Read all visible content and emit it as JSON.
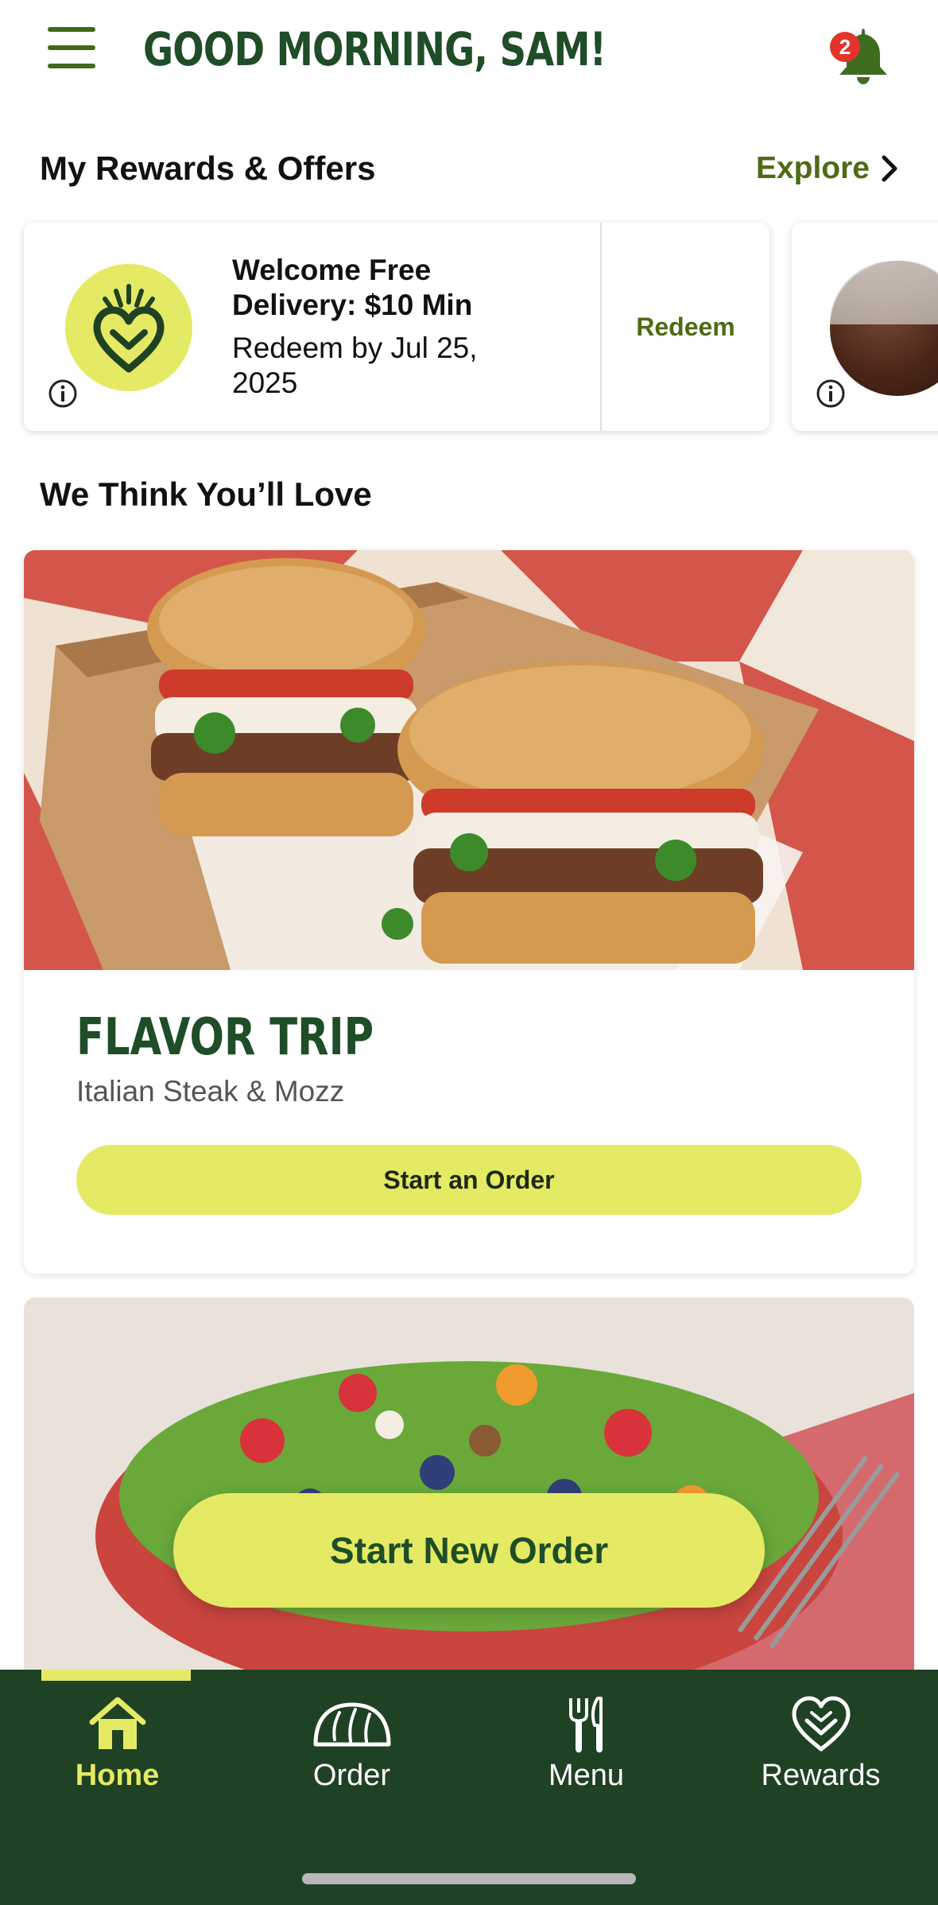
{
  "header": {
    "greeting": "GOOD MORNING, SAM!",
    "notification_count": "2"
  },
  "rewards": {
    "title": "My Rewards & Offers",
    "explore_label": "Explore",
    "offers": [
      {
        "title": "Welcome Free Delivery: $10 Min",
        "subtitle": "Redeem by Jul 25, 2025",
        "action_label": "Redeem"
      }
    ]
  },
  "recommendations": {
    "title": "We Think You’ll Love",
    "items": [
      {
        "name": "FLAVOR TRIP",
        "description": "Italian Steak & Mozz",
        "cta_label": "Start an Order"
      }
    ]
  },
  "floating_cta": {
    "label": "Start New Order"
  },
  "nav": {
    "items": [
      {
        "label": "Home",
        "icon": "home-icon",
        "active": true
      },
      {
        "label": "Order",
        "icon": "bread-icon",
        "active": false
      },
      {
        "label": "Menu",
        "icon": "utensils-icon",
        "active": false
      },
      {
        "label": "Rewards",
        "icon": "heart-rewards-icon",
        "active": false
      }
    ]
  },
  "colors": {
    "brand_green": "#1e4d28",
    "accent_lime": "#e4ea63",
    "nav_background": "#1f4124",
    "badge_red": "#e2342b",
    "link_olive": "#4d6b14"
  }
}
